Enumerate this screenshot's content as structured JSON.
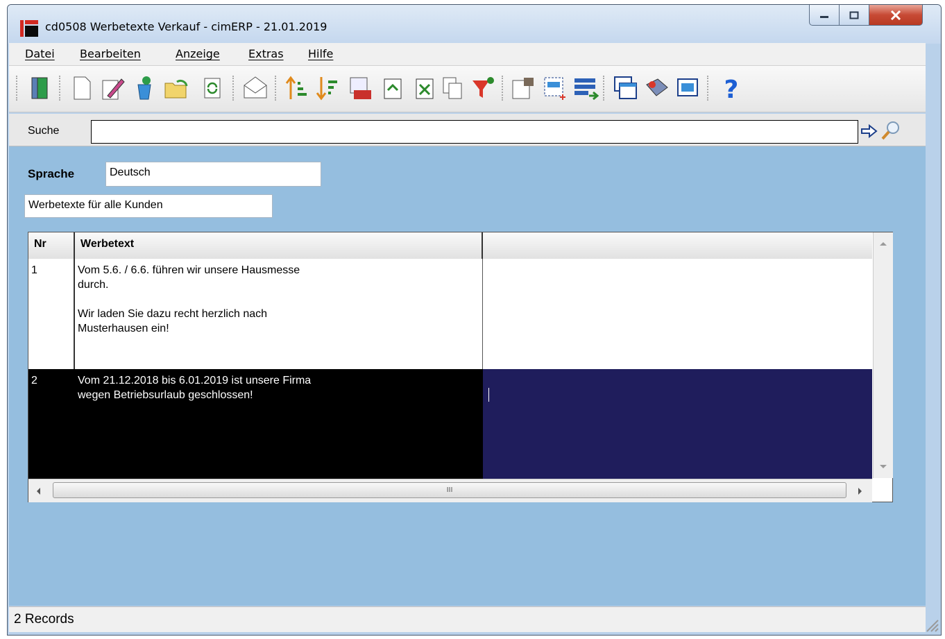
{
  "window": {
    "title": "cd0508 Werbetexte Verkauf - cimERP - 21.01.2019",
    "controls": {
      "minimize": "minimize-icon",
      "maximize": "maximize-icon",
      "close": "close-icon"
    }
  },
  "menu": [
    "Datei",
    "Bearbeiten",
    "Anzeige",
    "Extras",
    "Hilfe"
  ],
  "toolbar": {
    "icons": [
      "exit-door-icon",
      "new-document-icon",
      "edit-pencil-icon",
      "recycle-delete-icon",
      "open-folder-icon",
      "refresh-icon",
      "mail-icon",
      "sort-ascending-icon",
      "sort-descending-icon",
      "number-list-icon",
      "export-icon",
      "excel-export-icon",
      "copy-icon",
      "filter-funnel-icon",
      "properties-icon",
      "select-area-icon",
      "layout-arrow-icon",
      "windows-icon",
      "book-icon",
      "grid-settings-icon",
      "help-icon"
    ]
  },
  "search": {
    "label": "Suche",
    "value": "",
    "go_icon": "arrow-right-icon",
    "find_icon": "magnifier-icon"
  },
  "form": {
    "sprache_label": "Sprache",
    "sprache_value": "Deutsch",
    "description_value": "Werbetexte für alle Kunden"
  },
  "grid": {
    "columns": [
      "Nr",
      "Werbetext",
      ""
    ],
    "rows": [
      {
        "nr": "1",
        "text": "Vom 5.6. / 6.6. führen wir unsere Hausmesse\ndurch.\n\nWir laden Sie dazu recht herzlich nach\nMusterhausen ein!",
        "extra": "",
        "selected": false
      },
      {
        "nr": "2",
        "text": "Vom 21.12.2018 bis 6.01.2019 ist unsere Firma\nwegen Betriebsurlaub geschlossen!",
        "extra": "",
        "selected": true
      }
    ],
    "hscroll_thumb_glyph": "III"
  },
  "status": {
    "text": "2 Records"
  },
  "colors": {
    "background": "#95bedf",
    "selected_row": "#000000",
    "selected_cell": "#1f1d5c",
    "accent": "#d22a22"
  }
}
